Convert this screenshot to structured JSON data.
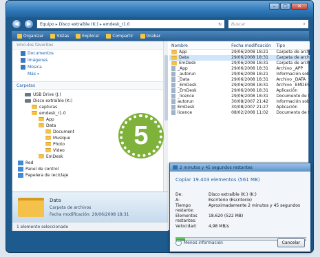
{
  "window": {
    "controls": {
      "minimize": "–",
      "maximize": "□",
      "close": "✕"
    }
  },
  "nav": {
    "back_icon": "back-arrow-icon",
    "forward_icon": "forward-arrow-icon",
    "breadcrumb": [
      "Equipo",
      "Disco extraíble (K:)",
      "emdesk_r1.0"
    ],
    "refresh_glyph": "↻",
    "search_placeholder": "Buscar"
  },
  "toolbar": {
    "items": [
      "Organizar",
      "Vistas",
      "Explorar",
      "Compartir",
      "Grabar"
    ]
  },
  "sidebar": {
    "favorites_header": "Vínculos favoritos",
    "favorites": [
      "Documentos",
      "Imágenes",
      "Música"
    ],
    "more_label": "Más »",
    "folders_header": "Carpetas",
    "tree": [
      {
        "label": "USB Drive (J:)",
        "icon": "drive",
        "indent": 1
      },
      {
        "label": "Disco extraíble (K:)",
        "icon": "drive",
        "indent": 1
      },
      {
        "label": "capturas",
        "icon": "folder",
        "indent": 2
      },
      {
        "label": "emdesk_r1.0",
        "icon": "folder",
        "indent": 2
      },
      {
        "label": "App",
        "icon": "folder",
        "indent": 3
      },
      {
        "label": "Data",
        "icon": "folder",
        "indent": 3
      },
      {
        "label": "Document",
        "icon": "folder",
        "indent": 4
      },
      {
        "label": "Musique",
        "icon": "folder",
        "indent": 4
      },
      {
        "label": "Photo",
        "icon": "folder",
        "indent": 4
      },
      {
        "label": "Video",
        "icon": "folder",
        "indent": 4
      },
      {
        "label": "EmDesk",
        "icon": "folder",
        "indent": 3
      },
      {
        "label": "Red",
        "icon": "network",
        "indent": 0
      },
      {
        "label": "Panel de control",
        "icon": "control",
        "indent": 0
      },
      {
        "label": "Papelera de reciclaje",
        "icon": "bin",
        "indent": 0
      }
    ]
  },
  "badge": {
    "number": "5"
  },
  "filelist": {
    "columns": [
      "Nombre",
      "Fecha modificación",
      "Tipo"
    ],
    "rows": [
      {
        "name": "App",
        "date": "29/06/2008 18:21",
        "type": "Carpeta de archivos",
        "icon": "folder"
      },
      {
        "name": "Data",
        "date": "29/06/2008 18:31",
        "type": "Carpeta de archivos",
        "icon": "folder",
        "selected": true
      },
      {
        "name": "EmDesk",
        "date": "29/06/2008 18:31",
        "type": "Carpeta de archivos",
        "icon": "folder"
      },
      {
        "name": "_App",
        "date": "29/06/2008 18:31",
        "type": "Archivo _APP",
        "icon": "file"
      },
      {
        "name": "_autorun",
        "date": "29/06/2008 18:21",
        "type": "Información sobre",
        "icon": "file"
      },
      {
        "name": "_Data",
        "date": "29/06/2008 18:31",
        "type": "Archivo _DATA",
        "icon": "file"
      },
      {
        "name": "_EmDesk",
        "date": "29/06/2008 18:31",
        "type": "Archivo _EMDESK",
        "icon": "file"
      },
      {
        "name": "_EmDesk",
        "date": "29/06/2008 18:31",
        "type": "Aplicación",
        "icon": "file"
      },
      {
        "name": "_licence",
        "date": "29/06/2008 18:31",
        "type": "Documento de texto",
        "icon": "file"
      },
      {
        "name": "autorun",
        "date": "30/08/2007 21:42",
        "type": "Información sobre",
        "icon": "file"
      },
      {
        "name": "EmDesk",
        "date": "30/08/2007 21:27",
        "type": "Aplicación",
        "icon": "file"
      },
      {
        "name": "licence",
        "date": "08/02/2008 11:02",
        "type": "Documento de texto",
        "icon": "file"
      }
    ]
  },
  "details": {
    "name": "Data",
    "type": "Carpeta de archivos",
    "date": "Fecha modificación: 29/06/2008 18:31"
  },
  "status": {
    "text": "1 elemento seleccionado"
  },
  "dialog": {
    "title": "2 minutos y 45 segundos restantes",
    "heading": "Copiar 19.403 elementos (561 MB)",
    "fields": [
      {
        "label": "De:",
        "value": "Disco extraíble (K:) (K:)"
      },
      {
        "label": "A:",
        "value": "Escritorio (Escritorio)"
      },
      {
        "label": "Tiempo restante:",
        "value": "Aproximadamente 2 minutos y 45 segundos"
      },
      {
        "label": "Elementos restantes:",
        "value": "18.620 (522 MB)"
      },
      {
        "label": "Velocidad:",
        "value": "4,98 MB/s"
      }
    ],
    "progress": 0.07,
    "more_label": "Menos información",
    "cancel_label": "Cancelar"
  },
  "colors": {
    "accent": "#1d5a8e",
    "badge": "#7fb23a",
    "selection": "#cfe5fb",
    "progress": "#3aa838"
  }
}
